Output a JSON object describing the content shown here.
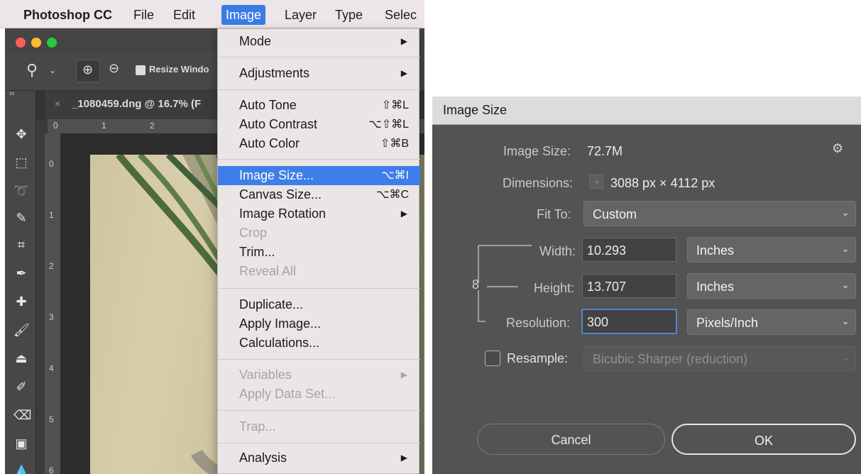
{
  "menubar": {
    "app": "Photoshop CC",
    "items": [
      "File",
      "Edit",
      "Image",
      "Layer",
      "Type",
      "Selec"
    ],
    "active": "Image"
  },
  "document": {
    "tab_title": "_1080459.dng @ 16.7% (F",
    "resize_option": "Resize Windo",
    "ruler_h": [
      "0",
      "1",
      "2"
    ],
    "ruler_v": [
      "0",
      "1",
      "2",
      "3",
      "4",
      "5",
      "6"
    ]
  },
  "image_menu": {
    "items": [
      {
        "label": "Mode",
        "shortcut": "",
        "submenu": true,
        "disabled": false
      },
      {
        "label": "Adjustments",
        "shortcut": "",
        "submenu": true,
        "disabled": false
      },
      {
        "label": "Auto Tone",
        "shortcut": "⇧⌘L",
        "submenu": false,
        "disabled": false
      },
      {
        "label": "Auto Contrast",
        "shortcut": "⌥⇧⌘L",
        "submenu": false,
        "disabled": false
      },
      {
        "label": "Auto Color",
        "shortcut": "⇧⌘B",
        "submenu": false,
        "disabled": false
      },
      {
        "label": "Image Size...",
        "shortcut": "⌥⌘I",
        "submenu": false,
        "disabled": false,
        "selected": true
      },
      {
        "label": "Canvas Size...",
        "shortcut": "⌥⌘C",
        "submenu": false,
        "disabled": false
      },
      {
        "label": "Image Rotation",
        "shortcut": "",
        "submenu": true,
        "disabled": false
      },
      {
        "label": "Crop",
        "shortcut": "",
        "submenu": false,
        "disabled": true
      },
      {
        "label": "Trim...",
        "shortcut": "",
        "submenu": false,
        "disabled": false
      },
      {
        "label": "Reveal All",
        "shortcut": "",
        "submenu": false,
        "disabled": true
      },
      {
        "label": "Duplicate...",
        "shortcut": "",
        "submenu": false,
        "disabled": false
      },
      {
        "label": "Apply Image...",
        "shortcut": "",
        "submenu": false,
        "disabled": false
      },
      {
        "label": "Calculations...",
        "shortcut": "",
        "submenu": false,
        "disabled": false
      },
      {
        "label": "Variables",
        "shortcut": "",
        "submenu": true,
        "disabled": true
      },
      {
        "label": "Apply Data Set...",
        "shortcut": "",
        "submenu": false,
        "disabled": true
      },
      {
        "label": "Trap...",
        "shortcut": "",
        "submenu": false,
        "disabled": true
      },
      {
        "label": "Analysis",
        "shortcut": "",
        "submenu": true,
        "disabled": false
      }
    ]
  },
  "dialog": {
    "title": "Image Size",
    "image_size_label": "Image Size:",
    "image_size_value": "72.7M",
    "dimensions_label": "Dimensions:",
    "dimensions_value": "3088 px  ×  4112 px",
    "fit_to_label": "Fit To:",
    "fit_to_value": "Custom",
    "width_label": "Width:",
    "width_value": "10.293",
    "width_unit": "Inches",
    "height_label": "Height:",
    "height_value": "13.707",
    "height_unit": "Inches",
    "resolution_label": "Resolution:",
    "resolution_value": "300",
    "resolution_unit": "Pixels/Inch",
    "resample_label": "Resample:",
    "resample_checked": false,
    "resample_value": "Bicubic Sharper (reduction)",
    "cancel_label": "Cancel",
    "ok_label": "OK"
  },
  "colors": {
    "menu_highlight": "#3f7ee8",
    "dialog_bg": "#535353",
    "photoshop_ui": "#474747"
  }
}
